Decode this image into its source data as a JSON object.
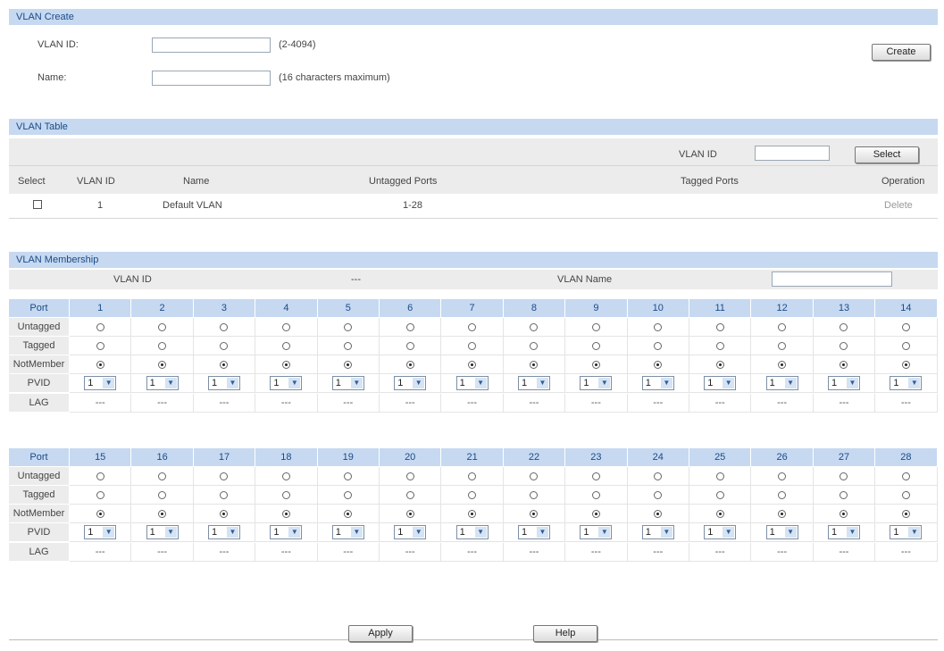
{
  "vlan_create": {
    "title": "VLAN Create",
    "vlan_id_label": "VLAN ID:",
    "vlan_id_value": "",
    "vlan_id_hint": "(2-4094)",
    "name_label": "Name:",
    "name_value": "",
    "name_hint": "(16 characters maximum)",
    "create_button": "Create"
  },
  "vlan_table": {
    "title": "VLAN Table",
    "filter_label": "VLAN ID",
    "filter_value": "",
    "select_button": "Select",
    "columns": [
      "Select",
      "VLAN ID",
      "Name",
      "Untagged Ports",
      "Tagged Ports",
      "Operation"
    ],
    "rows": [
      {
        "vlan_id": "1",
        "name": "Default VLAN",
        "untagged": "1-28",
        "tagged": "",
        "operation": "Delete"
      }
    ]
  },
  "vlan_membership": {
    "title": "VLAN Membership",
    "vlan_id_label": "VLAN ID",
    "vlan_id_value": "---",
    "vlan_name_label": "VLAN Name",
    "vlan_name_value": "",
    "row_labels": {
      "port": "Port",
      "untagged": "Untagged",
      "tagged": "Tagged",
      "notmember": "NotMember",
      "pvid": "PVID",
      "lag": "LAG"
    },
    "blocks": [
      {
        "ports": [
          "1",
          "2",
          "3",
          "4",
          "5",
          "6",
          "7",
          "8",
          "9",
          "10",
          "11",
          "12",
          "13",
          "14"
        ]
      },
      {
        "ports": [
          "15",
          "16",
          "17",
          "18",
          "19",
          "20",
          "21",
          "22",
          "23",
          "24",
          "25",
          "26",
          "27",
          "28"
        ]
      }
    ],
    "pvid_value": "1",
    "lag_value": "---",
    "selected_membership": "NotMember"
  },
  "footer": {
    "apply_button": "Apply",
    "help_button": "Help"
  },
  "colors": {
    "section_header": "#c6d9f1",
    "header_text": "#1c4a86",
    "row_bg": "#ececec"
  }
}
